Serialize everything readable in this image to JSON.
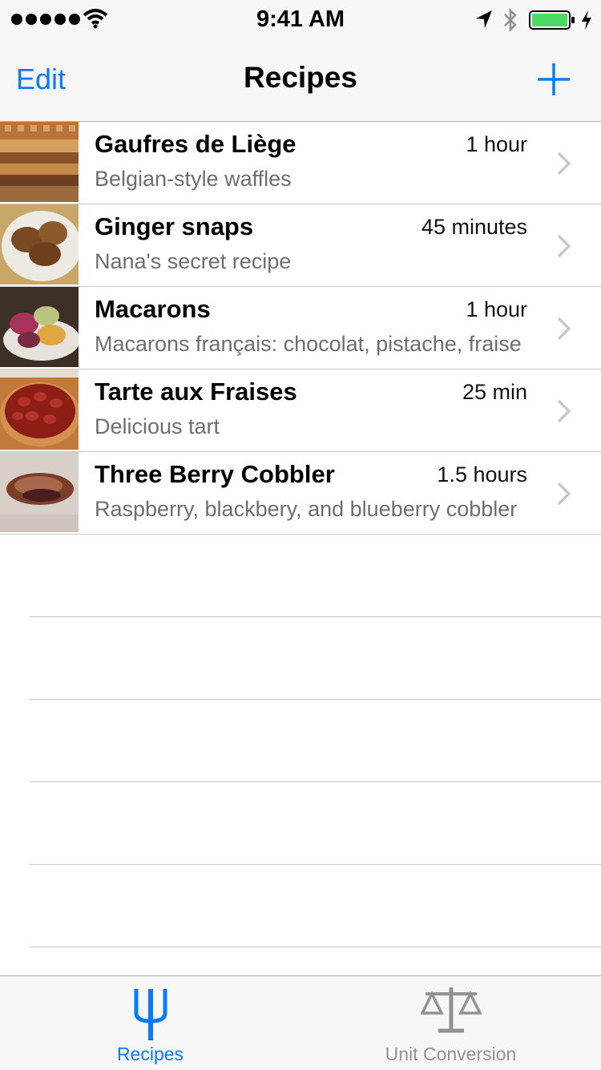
{
  "status_bar": {
    "time": "9:41 AM",
    "battery_color": "#4cd964"
  },
  "nav": {
    "edit_label": "Edit",
    "title": "Recipes",
    "add_icon": "plus-icon"
  },
  "recipes": [
    {
      "title": "Gaufres de Liège",
      "detail": "1 hour",
      "subtitle": "Belgian-style waffles"
    },
    {
      "title": "Ginger snaps",
      "detail": "45 minutes",
      "subtitle": "Nana's secret recipe"
    },
    {
      "title": "Macarons",
      "detail": "1 hour",
      "subtitle": "Macarons français: chocolat, pistache, fraise"
    },
    {
      "title": "Tarte aux Fraises",
      "detail": "25 min",
      "subtitle": "Delicious tart"
    },
    {
      "title": "Three Berry Cobbler",
      "detail": "1.5 hours",
      "subtitle": "Raspberry, blackbery, and blueberry cobbler"
    }
  ],
  "tabs": [
    {
      "label": "Recipes",
      "icon": "fork-icon",
      "selected": true
    },
    {
      "label": "Unit Conversion",
      "icon": "scale-icon",
      "selected": false
    }
  ],
  "colors": {
    "accent": "#0a7aff",
    "inactive_tab": "#929292",
    "subtitle": "#6d6d72"
  }
}
